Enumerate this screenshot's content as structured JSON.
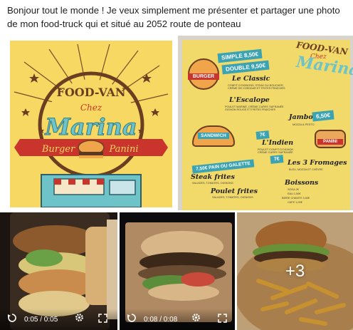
{
  "post": {
    "text": "Bonjour tout le monde ! Je veux simplement me présenter et partager une photo de mon food-truck  qui et situé au 2052 route de ponteau"
  },
  "logo": {
    "line1": "FOOD-VAN",
    "line2": "Chez",
    "line3": "Marina",
    "ribbon_left": "Burger",
    "ribbon_right": "Panini"
  },
  "menu": {
    "title1": "FOOD-VAN",
    "title2": "Chez",
    "title3": "Marina",
    "simple_price": "SIMPLE 8,50€",
    "double_price": "DOUBLE 9,50€",
    "burger_badge": "BURGER",
    "items": [
      {
        "name": "Le Classic",
        "desc": "CONFIT D'OIGNONS, STEAK DU BOUCHER, CRÈME DE CHEDDAR ET FRITES FRAÎCHES"
      },
      {
        "name": "L'Escalope",
        "desc": "POULET MARINÉ, CRÈME CURRY SAFRANÉE OIGNON ROUGE ET FRITES FRAÎCHES"
      },
      {
        "name": "Jambon",
        "desc": "MOZZA & PESTO"
      },
      {
        "name": "L'Indien",
        "desc": "POULET CONFIT D'OIGNON CRÈME CURRY SAFRANÉE"
      },
      {
        "name": "Les 3 Fromages",
        "desc": "BLEU, MOZZA ET CHÈVRE"
      }
    ],
    "panini_price": "6,50€",
    "sandwich_badge": "SANDWICH",
    "panini_badge": "PANINI",
    "seven1": "7€",
    "seven2": "7€",
    "galette_price": "7,50€ PAIN OU GALETTE",
    "steak_frites": "Steak frites",
    "steak_desc": "SALADES, TOMATES, OIGNONS",
    "poulet_frites": "Poulet frites",
    "poulet_desc": "SALADES, TOMATES, OIGNONS",
    "boissons_title": "Boissons",
    "boissons": [
      "SODA 2€",
      "EAU 1,50€",
      "BIERE CHAMTE 3,50€",
      "CAFE 1,00€"
    ]
  },
  "videos": [
    {
      "time": "0:05 / 0:05"
    },
    {
      "time": "0:08 / 0:08"
    }
  ],
  "more_photos": "+3",
  "colors": {
    "logo_yellow": "#f6d862",
    "teal": "#3ba3b2",
    "red": "#c9352c",
    "brown": "#6b3e22"
  },
  "icons": [
    "replay-icon",
    "settings-gear-icon",
    "fullscreen-icon"
  ]
}
